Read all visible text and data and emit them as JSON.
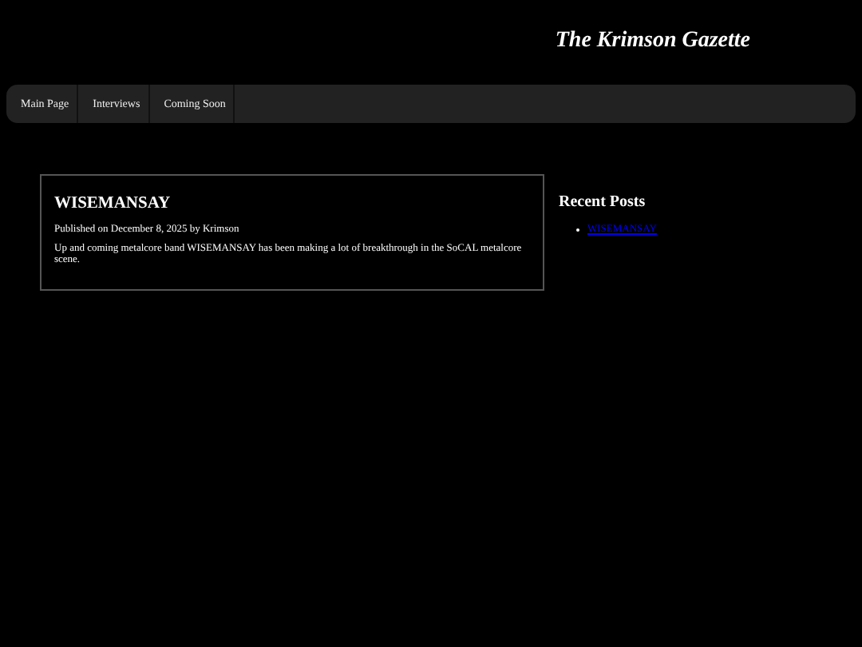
{
  "site_title": "The Krimson Gazette",
  "nav": [
    {
      "label": "Main Page"
    },
    {
      "label": "Interviews"
    },
    {
      "label": "Coming Soon"
    }
  ],
  "post": {
    "title": "WISEMANSAY",
    "meta": "Published on December 8, 2025 by Krimson",
    "excerpt": "Up and coming metalcore band WISEMANSAY has been making a lot of breakthrough in the SoCAL metalcore scene."
  },
  "sidebar": {
    "heading": "Recent Posts",
    "links": [
      "WISEMANSAY"
    ]
  }
}
